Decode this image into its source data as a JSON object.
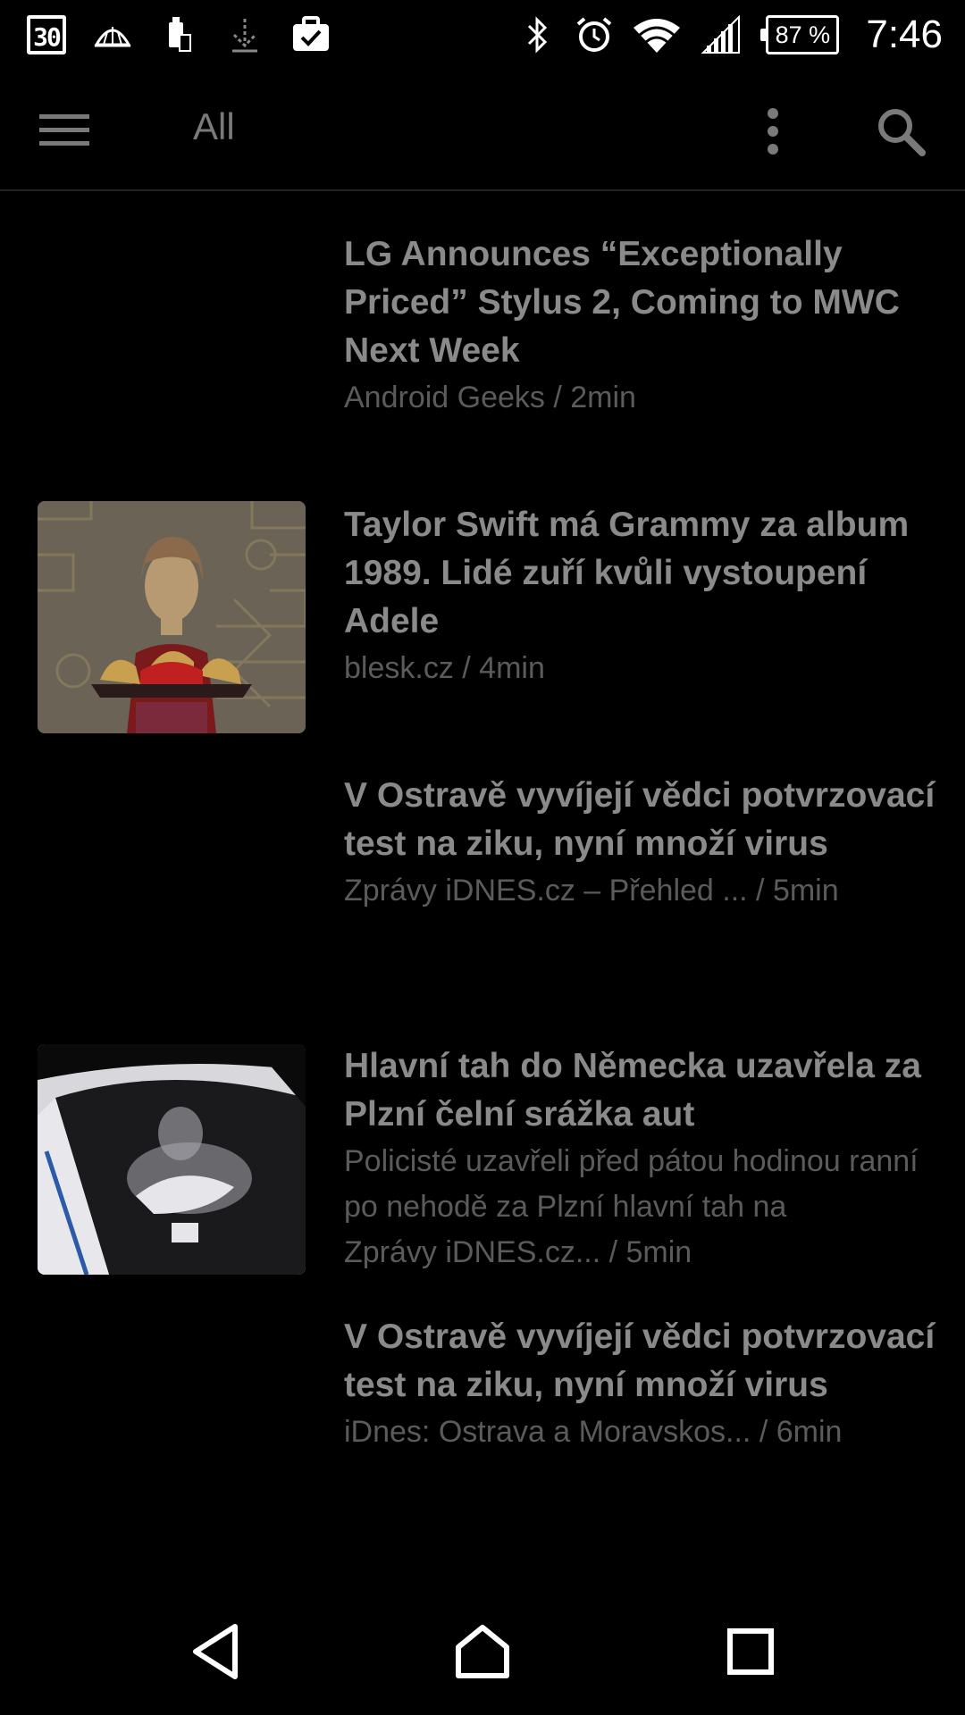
{
  "status_bar": {
    "calendar_day": "30",
    "battery": "87 %",
    "time": "7:46",
    "icons_left": [
      "calendar-icon",
      "vpn-dome-icon",
      "phone-sync-icon",
      "download-icon",
      "briefcase-check-icon"
    ],
    "icons_right": [
      "bluetooth-icon",
      "alarm-icon",
      "wifi-icon",
      "signal-icon",
      "battery-icon"
    ]
  },
  "toolbar": {
    "title": "All",
    "menu_icon": "hamburger-menu-icon",
    "more_icon": "more-vert-icon",
    "search_icon": "search-icon"
  },
  "articles": [
    {
      "headline": "LG Announces “Exceptionally Priced” Stylus 2, Coming to MWC Next Week",
      "snippet": "",
      "source": "Android Geeks",
      "time": "2min",
      "has_image": false
    },
    {
      "headline": "Taylor Swift má Grammy za album 1989. Lidé zuří kvůli vystoupení Adele",
      "snippet": "",
      "source": "blesk.cz",
      "time": "4min",
      "has_image": true
    },
    {
      "headline": "V Ostravě vyvíjejí vědci potvrzovací test na ziku, nyní množí virus",
      "snippet": "",
      "source": "Zprávy iDNES.cz – Přehled ...",
      "time": "5min",
      "has_image": false
    },
    {
      "headline": "Hlavní tah do Německa uzavřela za Plzní čelní srážka aut",
      "snippet": "Policisté uzavřeli před pátou hodinou ranní po nehodě za Plzní hlavní tah na",
      "source": "Zprávy iDNES.cz...",
      "time": "5min",
      "has_image": true
    },
    {
      "headline": "V Ostravě vyvíjejí vědci potvrzovací test na ziku, nyní množí virus",
      "snippet": "",
      "source": "iDnes: Ostrava a Moravskos...",
      "time": "6min",
      "has_image": false
    }
  ],
  "navbar": {
    "back_icon": "back-triangle-icon",
    "home_icon": "home-icon",
    "recents_icon": "recents-square-icon"
  }
}
